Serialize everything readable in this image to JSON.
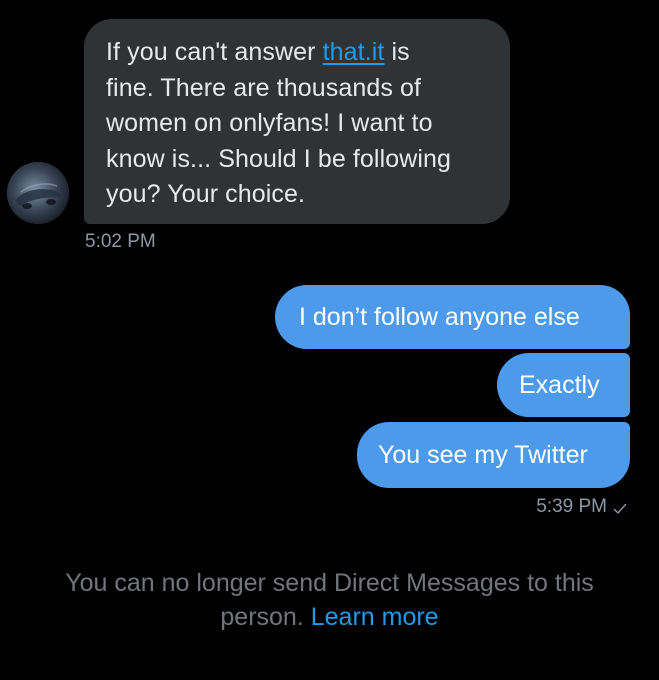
{
  "conversation": {
    "incoming": {
      "lines": [
        {
          "before": "If you can't answer ",
          "link": "that.it",
          "after": " is"
        },
        "fine. There are thousands of",
        "women on onlyfans! I want to",
        "know is... Should I be following",
        "you? Your choice."
      ],
      "timestamp": "5:02 PM",
      "avatar_icon": "user-avatar"
    },
    "outgoing": [
      {
        "text": "I don’t follow anyone else"
      },
      {
        "text": "Exactly"
      },
      {
        "text": "You see my Twitter"
      }
    ],
    "outgoing_timestamp": "5:39 PM",
    "read_icon": "check-icon"
  },
  "notice": {
    "line1": "You can no longer send Direct Messages to this",
    "line2_prefix": "person. ",
    "learn_more": "Learn more"
  },
  "colors": {
    "background": "#000000",
    "incoming_bubble": "#2f3336",
    "outgoing_bubble": "#4e9aea",
    "link": "#1d9bf0",
    "muted_text": "#8b98a5"
  }
}
